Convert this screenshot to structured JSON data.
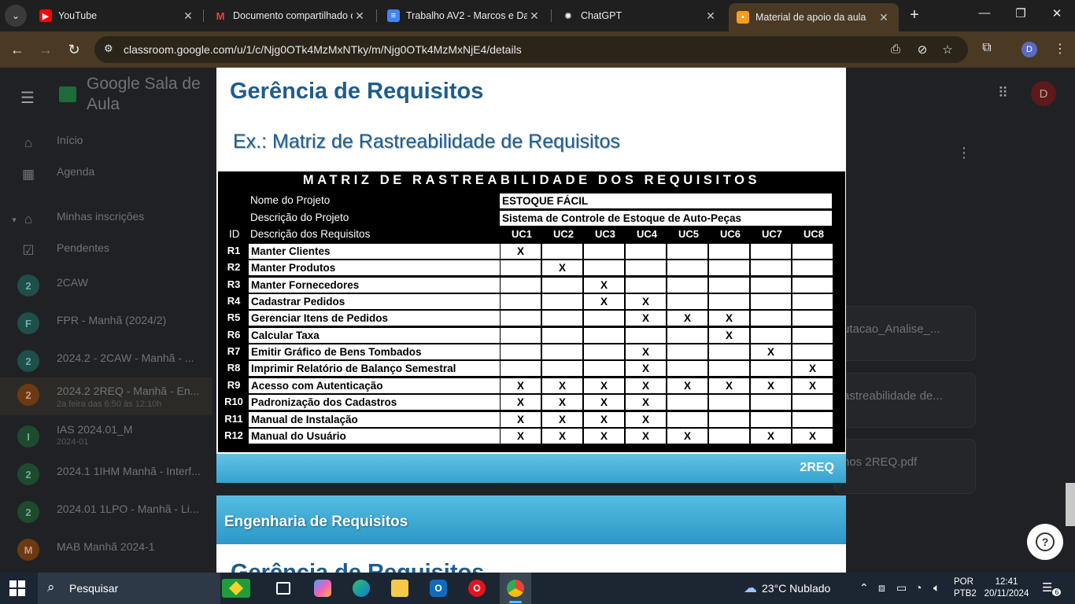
{
  "tabs": [
    {
      "title": "YouTube",
      "icon": "youtube-icon",
      "color": "#ff0000"
    },
    {
      "title": "Documento compartilhado c",
      "icon": "gmail-icon",
      "color": "#ea4335"
    },
    {
      "title": "Trabalho AV2 - Marcos e Da",
      "icon": "docs-icon",
      "color": "#4285f4"
    },
    {
      "title": "ChatGPT",
      "icon": "chatgpt-icon",
      "color": "#ffffff"
    },
    {
      "title": "Material de apoio da aula",
      "icon": "classroom-icon",
      "color": "#f4a01c"
    }
  ],
  "toolbar": {
    "url": "classroom.google.com/u/1/c/Njg0OTk4MzMxNTky/m/Njg0OTk4MzMxNjE4/details",
    "profile_initial": "D"
  },
  "classroom": {
    "app_title": "Google Sala de Aula",
    "avatar_initial": "D",
    "sidebar": [
      {
        "label": "Início",
        "icon": "home-icon"
      },
      {
        "label": "Agenda",
        "icon": "calendar-icon"
      },
      {
        "label": "Minhas inscrições",
        "icon": "school-icon"
      },
      {
        "label": "Pendentes",
        "icon": "checklist-icon"
      },
      {
        "label": "2CAW",
        "initial": "2",
        "color": "#1e4f4b"
      },
      {
        "label": "FPR - Manhã (2024/2)",
        "initial": "F",
        "color": "#1e4f4b"
      },
      {
        "label": "2024.2 - 2CAW - Manhã - ...",
        "initial": "2",
        "color": "#1e4f4b"
      },
      {
        "label": "2024.2 2REQ - Manhã - En...",
        "sub": "2a feira das 6:50 às 12:10h",
        "initial": "2",
        "color": "#6b3a12"
      },
      {
        "label": "IAS 2024.01_M",
        "sub": "2024-01",
        "initial": "I",
        "color": "#1e4a2e"
      },
      {
        "label": "2024.1 1IHM Manhã - Interf...",
        "initial": "2",
        "color": "#1e4a2e"
      },
      {
        "label": "2024.01 1LPO - Manhã - Li...",
        "initial": "2",
        "color": "#1e4a2e"
      },
      {
        "label": "MAB Manhã 2024-1",
        "initial": "M",
        "color": "#6b3a12"
      }
    ],
    "cards": [
      "utacao_Analise_...",
      "astreabilidade de...",
      "nos 2REQ.pdf"
    ]
  },
  "slide1": {
    "title": "Gerência de Requisitos",
    "subtitle": "Ex.: Matriz de Rastreabilidade de Requisitos",
    "footer": "2REQ"
  },
  "matrix": {
    "header": "MATRIZ DE RASTREABILIDADE DOS REQUISITOS",
    "project_name_label": "Nome do Projeto",
    "project_name": "ESTOQUE FÁCIL",
    "project_desc_label": "Descrição do Projeto",
    "project_desc": "Sistema de Controle de Estoque de Auto-Peças",
    "id_label": "ID",
    "req_desc_label": "Descrição dos Requisitos",
    "use_cases": [
      "UC1",
      "UC2",
      "UC3",
      "UC4",
      "UC5",
      "UC6",
      "UC7",
      "UC8"
    ],
    "rows": [
      {
        "id": "R1",
        "desc": "Manter Clientes",
        "marks": [
          1,
          0,
          0,
          0,
          0,
          0,
          0,
          0
        ]
      },
      {
        "id": "R2",
        "desc": "Manter Produtos",
        "marks": [
          0,
          1,
          0,
          0,
          0,
          0,
          0,
          0
        ]
      },
      {
        "id": "R3",
        "desc": "Manter Fornecedores",
        "marks": [
          0,
          0,
          1,
          0,
          0,
          0,
          0,
          0
        ]
      },
      {
        "id": "R4",
        "desc": "Cadastrar Pedidos",
        "marks": [
          0,
          0,
          1,
          1,
          0,
          0,
          0,
          0
        ]
      },
      {
        "id": "R5",
        "desc": "Gerenciar Itens de Pedidos",
        "marks": [
          0,
          0,
          0,
          1,
          1,
          1,
          0,
          0
        ]
      },
      {
        "id": "R6",
        "desc": "Calcular Taxa",
        "marks": [
          0,
          0,
          0,
          0,
          0,
          1,
          0,
          0
        ]
      },
      {
        "id": "R7",
        "desc": "Emitir Gráfico de Bens Tombados",
        "marks": [
          0,
          0,
          0,
          1,
          0,
          0,
          1,
          0
        ]
      },
      {
        "id": "R8",
        "desc": "Imprimir Relatório de Balanço Semestral",
        "marks": [
          0,
          0,
          0,
          1,
          0,
          0,
          0,
          1
        ]
      },
      {
        "id": "R9",
        "desc": "Acesso com Autenticação",
        "marks": [
          1,
          1,
          1,
          1,
          1,
          1,
          1,
          1
        ]
      },
      {
        "id": "R10",
        "desc": "Padronização dos Cadastros",
        "marks": [
          1,
          1,
          1,
          1,
          0,
          0,
          0,
          0
        ]
      },
      {
        "id": "R11",
        "desc": "Manual de Instalação",
        "marks": [
          1,
          1,
          1,
          1,
          0,
          0,
          0,
          0
        ]
      },
      {
        "id": "R12",
        "desc": "Manual do Usuário",
        "marks": [
          1,
          1,
          1,
          1,
          1,
          0,
          1,
          1
        ]
      }
    ],
    "mark_symbol": "X"
  },
  "slide2": {
    "band_title": "Engenharia de Requisitos",
    "next_title": "Gerência de Requisitos"
  },
  "taskbar": {
    "search_placeholder": "Pesquisar",
    "weather": "23°C  Nublado",
    "lang_line1": "POR",
    "lang_line2": "PTB2",
    "time": "12:41",
    "date": "20/11/2024",
    "notif_count": "6"
  }
}
